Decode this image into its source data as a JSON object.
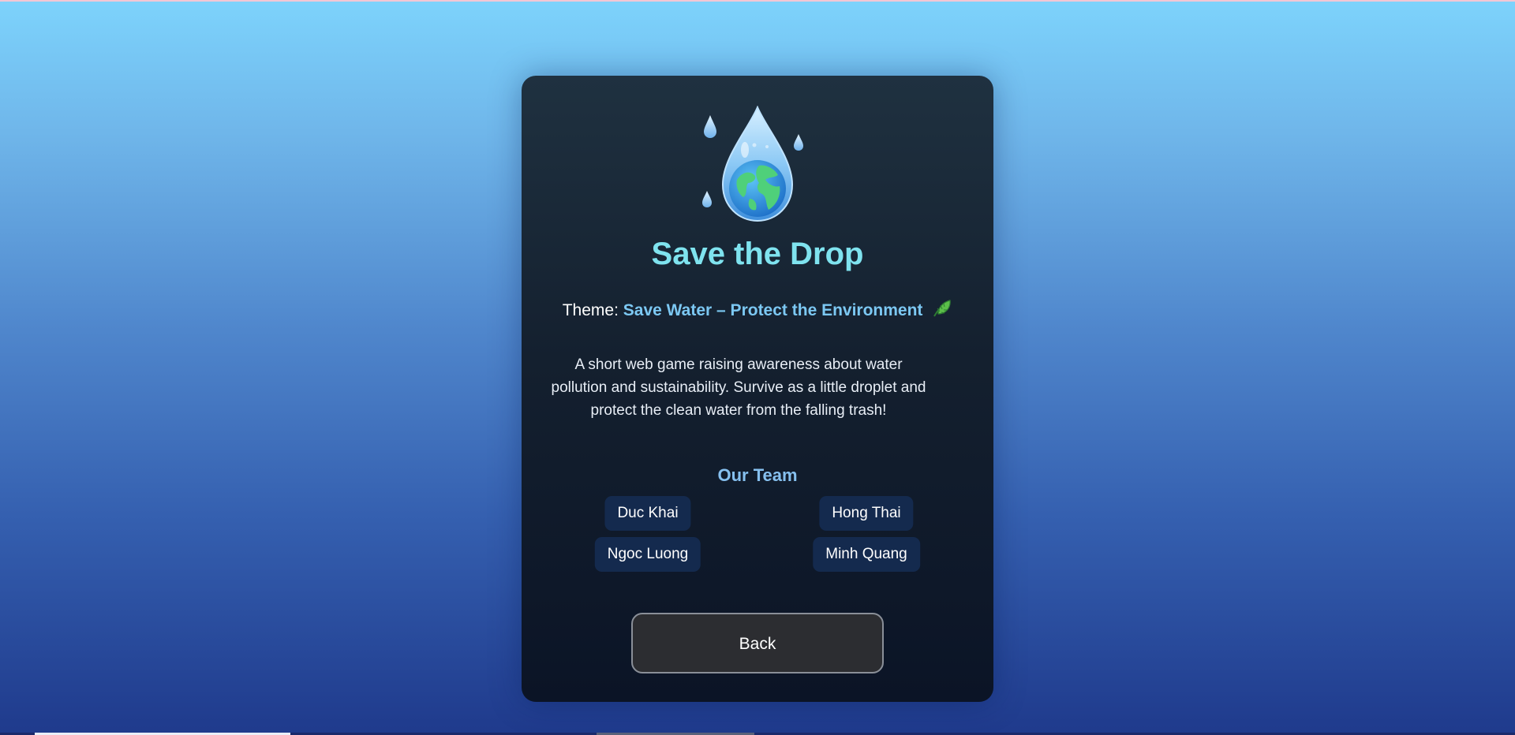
{
  "game": {
    "title": "Save the Drop",
    "logo_icon": "water-drop-earth-icon"
  },
  "theme": {
    "label": "Theme:",
    "value": "Save Water – Protect the Environment",
    "icon": "leaf-icon"
  },
  "description": "A short web game raising awareness about water pollution and sustainability. Survive as a little droplet and protect the clean water from the falling trash!",
  "team": {
    "heading": "Our Team",
    "members": [
      "Duc Khai",
      "Hong Thai",
      "Ngoc Luong",
      "Minh Quang"
    ]
  },
  "buttons": {
    "back_label": "Back"
  },
  "colors": {
    "title": "#7fe3ef",
    "theme_value": "#7cc8f3",
    "team_heading": "#86c0ef",
    "member_chip": "#142a4e",
    "card_top": "#1f3140",
    "card_bottom": "#0b1426",
    "background_top": "#7dd3fc",
    "background_bottom": "#1f3a8c"
  }
}
